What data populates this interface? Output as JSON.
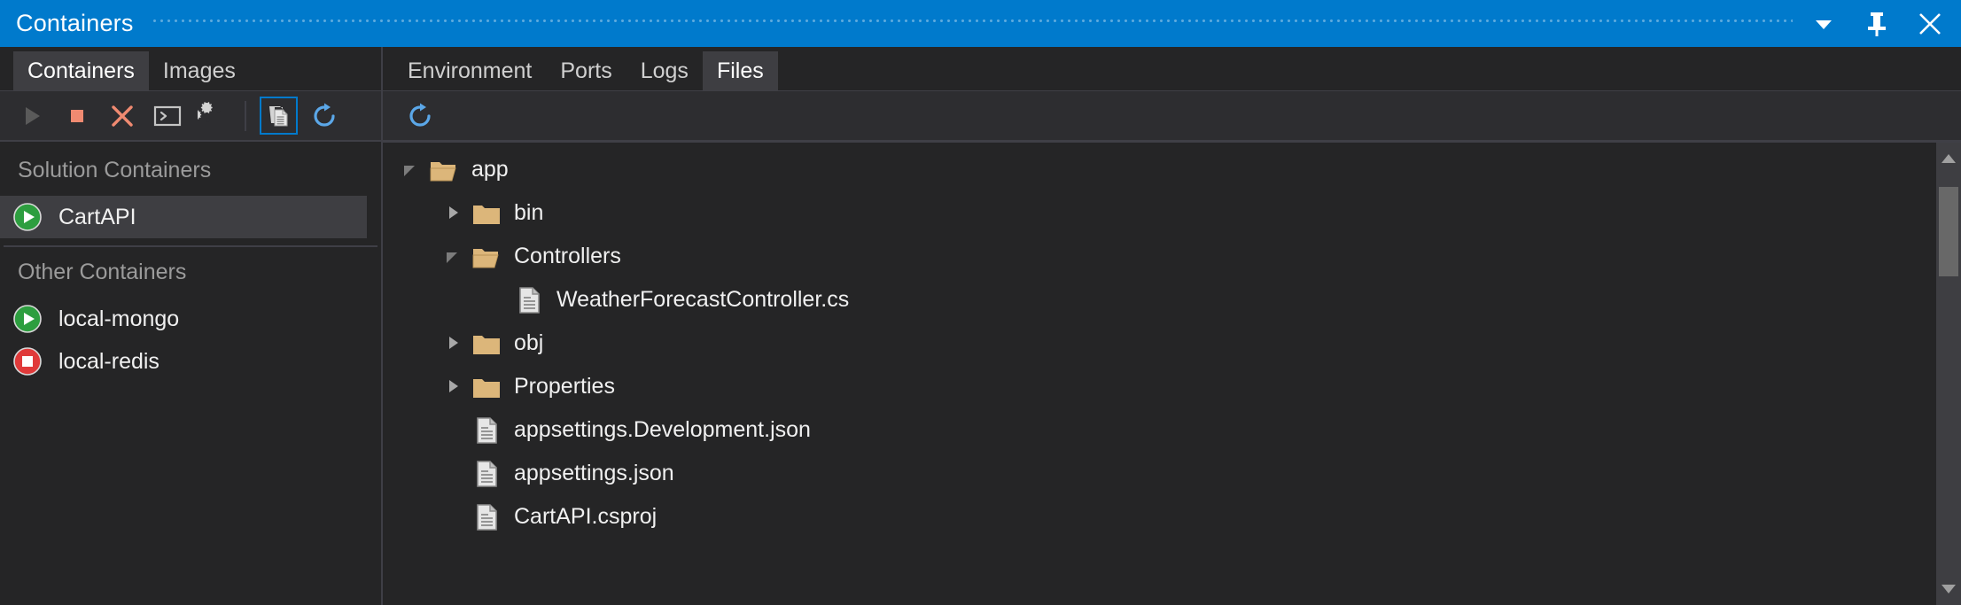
{
  "window": {
    "title": "Containers",
    "accent_color": "#007ACC",
    "background_color": "#252526",
    "controls": [
      {
        "name": "dropdown-menu-button",
        "icon": "chevron-down-icon",
        "label": "▼"
      },
      {
        "name": "pin-button",
        "icon": "pin-icon",
        "label": "Pin"
      },
      {
        "name": "close-button",
        "icon": "close-icon",
        "label": "Close"
      }
    ]
  },
  "left_pane": {
    "tabs": [
      {
        "label": "Containers",
        "active": true
      },
      {
        "label": "Images",
        "active": false
      }
    ],
    "toolbar": [
      {
        "name": "start-button",
        "icon": "play-icon",
        "tooltip": "Start",
        "state": "disabled"
      },
      {
        "name": "stop-button",
        "icon": "stop-square-icon",
        "tooltip": "Stop",
        "state": "enabled"
      },
      {
        "name": "remove-button",
        "icon": "close-x-icon",
        "tooltip": "Remove",
        "state": "enabled"
      },
      {
        "name": "open-terminal-button",
        "icon": "terminal-icon",
        "tooltip": "Open Terminal",
        "state": "enabled"
      },
      {
        "name": "settings-button",
        "icon": "gears-icon",
        "tooltip": "Settings",
        "state": "enabled"
      },
      {
        "name": "view-files-button",
        "icon": "copy-files-icon",
        "tooltip": "Files",
        "state": "toggled"
      },
      {
        "name": "refresh-button",
        "icon": "refresh-icon",
        "tooltip": "Refresh",
        "state": "enabled"
      }
    ],
    "groups": [
      {
        "header": "Solution Containers",
        "items": [
          {
            "label": "CartAPI",
            "status": "running",
            "status_icon": "play-circle-green-icon",
            "selected": true
          }
        ]
      },
      {
        "header": "Other Containers",
        "items": [
          {
            "label": "local-mongo",
            "status": "running",
            "status_icon": "play-circle-green-icon",
            "selected": false
          },
          {
            "label": "local-redis",
            "status": "stopped",
            "status_icon": "stop-circle-red-icon",
            "selected": false
          }
        ]
      }
    ]
  },
  "right_pane": {
    "tabs": [
      {
        "label": "Environment",
        "active": false
      },
      {
        "label": "Ports",
        "active": false
      },
      {
        "label": "Logs",
        "active": false
      },
      {
        "label": "Files",
        "active": true
      }
    ],
    "toolbar": [
      {
        "name": "refresh-files-button",
        "icon": "refresh-icon",
        "tooltip": "Refresh"
      }
    ],
    "file_tree": [
      {
        "label": "app",
        "type": "folder",
        "depth": 0,
        "expanded": true
      },
      {
        "label": "bin",
        "type": "folder",
        "depth": 1,
        "expanded": false
      },
      {
        "label": "Controllers",
        "type": "folder",
        "depth": 1,
        "expanded": true
      },
      {
        "label": "WeatherForecastController.cs",
        "type": "file",
        "depth": 2,
        "expanded": null
      },
      {
        "label": "obj",
        "type": "folder",
        "depth": 1,
        "expanded": false
      },
      {
        "label": "Properties",
        "type": "folder",
        "depth": 1,
        "expanded": false
      },
      {
        "label": "appsettings.Development.json",
        "type": "file",
        "depth": 1,
        "expanded": null
      },
      {
        "label": "appsettings.json",
        "type": "file",
        "depth": 1,
        "expanded": null
      },
      {
        "label": "CartAPI.csproj",
        "type": "file",
        "depth": 1,
        "expanded": null
      }
    ],
    "scrollbar": {
      "up_arrow": "scroll-up-icon",
      "down_arrow": "scroll-down-icon",
      "thumb_position_percent": 4,
      "thumb_size_percent": 22
    }
  },
  "colors": {
    "folder": "#DCB67A",
    "file": "#C5C5C5",
    "running": "#2D9E3F",
    "stopped": "#E03A3A",
    "toolbar_action": "#F08A71",
    "refresh": "#5BA7E8"
  }
}
